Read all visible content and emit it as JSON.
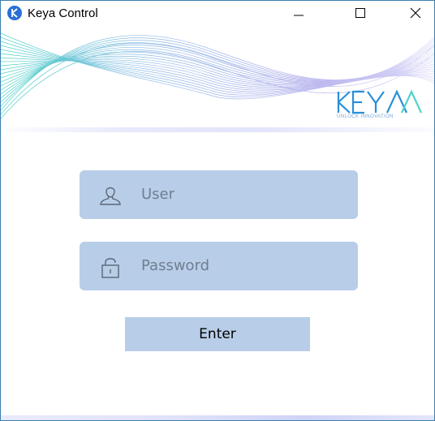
{
  "window": {
    "title": "Keya Control",
    "controls": [
      "minimize",
      "maximize",
      "close"
    ]
  },
  "brand": {
    "logo_text": "KEYA",
    "tagline": "UNLOCK INNOVATION",
    "accent": "#2a8fd8"
  },
  "login": {
    "user_placeholder": "User",
    "password_placeholder": "Password",
    "enter_label": "Enter",
    "field_color": "#b8cde8"
  },
  "icons": {
    "app": "keya-app-icon",
    "user": "user-icon",
    "password": "lock-icon"
  }
}
